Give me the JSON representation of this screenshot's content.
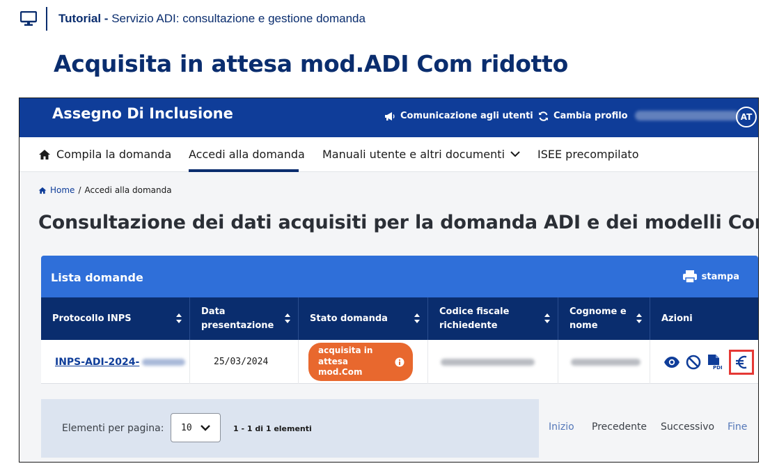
{
  "tutorial": {
    "label": "Tutorial -",
    "subtitle": "Servizio ADI: consultazione e gestione domanda"
  },
  "heading": "Acquisita in attesa mod.ADI Com ridotto",
  "app": {
    "brand": "Assegno Di Inclusione",
    "comunicazione": "Comunicazione agli utenti",
    "cambia_profilo": "Cambia profilo",
    "avatar_initials": "AT"
  },
  "nav": {
    "items": [
      {
        "label": "Compila la domanda"
      },
      {
        "label": "Accedi alla domanda"
      },
      {
        "label": "Manuali utente e altri documenti"
      },
      {
        "label": "ISEE precompilato"
      }
    ]
  },
  "breadcrumb": {
    "home": "Home",
    "separator": "/",
    "current": "Accedi alla domanda"
  },
  "page_title": "Consultazione dei dati acquisiti per la domanda ADI e dei modelli Com",
  "list": {
    "title": "Lista domande",
    "print_label": "stampa",
    "columns": [
      "Protocollo INPS",
      "Data presentazione",
      "Stato domanda",
      "Codice fiscale richiedente",
      "Cognome e nome",
      "Azioni"
    ],
    "rows": [
      {
        "protocollo": "INPS-ADI-2024-",
        "data": "25/03/2024",
        "stato": "acquisita in attesa mod.Com"
      }
    ]
  },
  "pagination": {
    "per_page_label": "Elementi per pagina:",
    "per_page_value": "10",
    "range": "1 - 1 di 1 elementi",
    "inizio": "Inizio",
    "precedente": "Precedente",
    "successivo": "Successivo",
    "fine": "Fine"
  },
  "colors": {
    "primary": "#0f3d99",
    "dark": "#0a2d6e",
    "card_header": "#2f6fd9",
    "badge": "#e8682e",
    "highlight": "#e53935"
  }
}
